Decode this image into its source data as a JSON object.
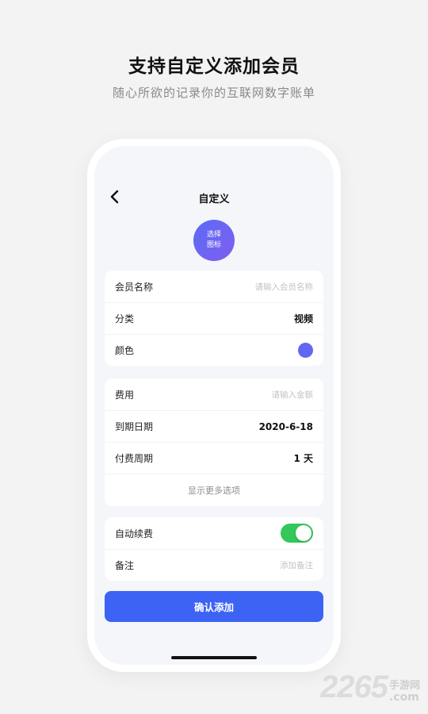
{
  "hero": {
    "title": "支持自定义添加会员",
    "subtitle": "随心所欲的记录你的互联网数字账单"
  },
  "nav": {
    "back_icon": "chevron-left-icon",
    "title": "自定义"
  },
  "icon_picker": {
    "line1": "选择",
    "line2": "图标",
    "color_start": "#5b6cf6",
    "color_end": "#7f5ef0"
  },
  "card1": {
    "name_label": "会员名称",
    "name_placeholder": "请输入会员名称",
    "category_label": "分类",
    "category_value": "视频",
    "color_label": "颜色",
    "color_value": "#6366f1"
  },
  "card2": {
    "fee_label": "费用",
    "fee_placeholder": "请输入金额",
    "expiry_label": "到期日期",
    "expiry_value": "2020-6-18",
    "cycle_label": "付费周期",
    "cycle_value": "1 天",
    "more_label": "显示更多选项"
  },
  "card3": {
    "auto_renew_label": "自动续费",
    "auto_renew_on": true,
    "note_label": "备注",
    "note_placeholder": "添加备注"
  },
  "confirm_label": "确认添加",
  "watermark": {
    "number": "2265",
    "cn": "手游网",
    "com": ".com"
  },
  "colors": {
    "accent": "#3d63f5",
    "toggle_on": "#34c759"
  }
}
